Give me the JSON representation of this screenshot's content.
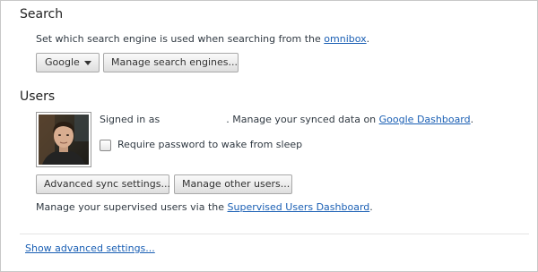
{
  "search": {
    "title": "Search",
    "description_prefix": "Set which search engine is used when searching from the ",
    "omnibox_link": "omnibox",
    "description_suffix": ".",
    "engine_selected": "Google",
    "manage_button": "Manage search engines..."
  },
  "users": {
    "title": "Users",
    "signed_in_prefix": "Signed in as",
    "signed_in_middle": ". Manage your synced data on ",
    "dashboard_link": "Google Dashboard",
    "signed_in_suffix": ".",
    "require_password_label": "Require password to wake from sleep",
    "require_password_checked": false,
    "advanced_sync_button": "Advanced sync settings...",
    "manage_other_users_button": "Manage other users...",
    "supervised_prefix": "Manage your supervised users via the ",
    "supervised_link": "Supervised Users Dashboard",
    "supervised_suffix": "."
  },
  "footer": {
    "show_advanced_link": "Show advanced settings..."
  },
  "colors": {
    "link": "#1a5fb4",
    "text": "#303942",
    "button_border": "#a8a8a8"
  }
}
